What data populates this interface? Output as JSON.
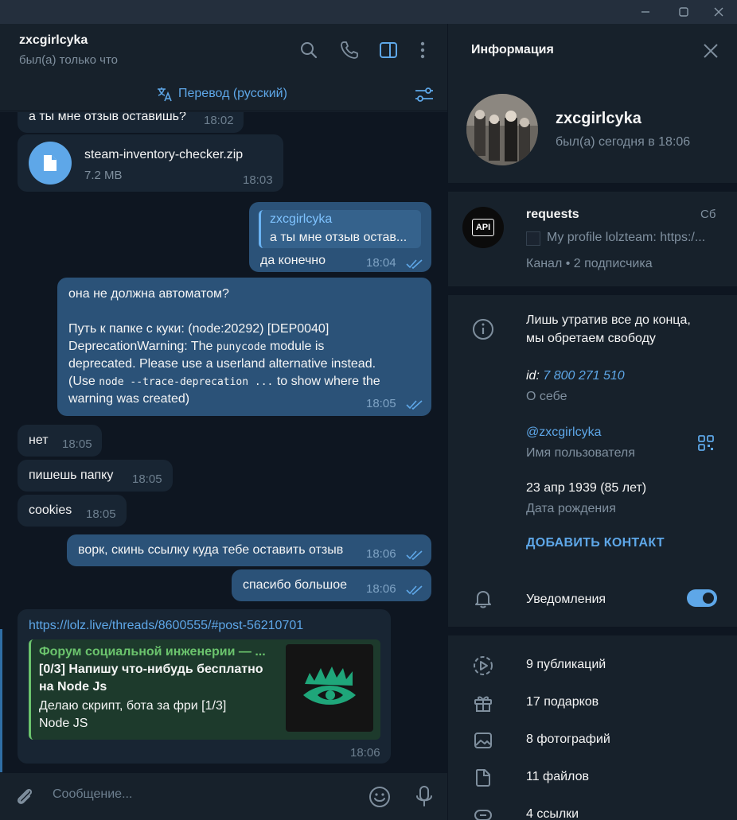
{
  "chat": {
    "peer_name": "zxcgirlcyka",
    "peer_status": "был(а) только что",
    "translate_label": "Перевод (русский)",
    "composer_placeholder": "Сообщение...",
    "messages": {
      "m1": {
        "text": "а ты мне отзыв оставишь?",
        "time": "18:02"
      },
      "file": {
        "name": "steam-inventory-checker.zip",
        "size": "7.2 MB",
        "time": "18:03"
      },
      "m3": {
        "reply_name": "zxcgirlcyka",
        "reply_text": "а ты мне отзыв остав...",
        "text": "да конечно",
        "time": "18:04"
      },
      "m4": {
        "line1": "она не должна автоматом?",
        "line2": "Путь к папке с куки: (node:20292) [DEP0040]",
        "line3a": "DeprecationWarning: The ",
        "line3code": "punycode",
        "line3b": " module is",
        "line4": "deprecated. Please use a userland alternative instead.",
        "line5a": "(Use ",
        "line5code": "node --trace-deprecation ...",
        "line5b": " to show where the",
        "line6": "warning was created)",
        "time": "18:05"
      },
      "m5": {
        "text": "нет",
        "time": "18:05"
      },
      "m6": {
        "text": "пишешь папку",
        "time": "18:05"
      },
      "m7": {
        "text": "cookies",
        "time": "18:05"
      },
      "m8": {
        "text": "ворк, скинь ссылку куда тебе оставить отзыв",
        "time": "18:06"
      },
      "m9": {
        "text": "спасибо большое",
        "time": "18:06"
      },
      "m10": {
        "link": "https://lolz.live/threads/8600555/#post-56210701",
        "preview_site": "Форум социальной инженерии — ...",
        "preview_title_1": "[0/3] Напишу что-нибудь бесплатно",
        "preview_title_2": "на Node Js",
        "preview_desc_1": "Делаю скрипт, бота за фри [1/3]",
        "preview_desc_2": "Node JS",
        "time": "18:06"
      }
    }
  },
  "info": {
    "title": "Информация",
    "name": "zxcgirlcyka",
    "status": "был(а) сегодня в 18:06",
    "channel": {
      "name": "requests",
      "day": "Сб",
      "last_message": "My profile lolzteam: https:/...",
      "meta": "Канал • 2 подписчика",
      "avatar_label": "API"
    },
    "bio": {
      "line1": "Лишь утратив все до конца,",
      "line2": "мы обретаем свободу"
    },
    "id": {
      "prefix": "id: ",
      "value": "7 800 271 510",
      "label": "О себе"
    },
    "username": {
      "value": "@zxcgirlcyka",
      "label": "Имя пользователя"
    },
    "birthday": {
      "value": "23 апр 1939 (85 лет)",
      "label": "Дата рождения"
    },
    "add_contact": "ДОБАВИТЬ КОНТАКТ",
    "notifications": {
      "label": "Уведомления",
      "enabled": true
    },
    "media": {
      "posts": "9 публикаций",
      "gifts": "17 подарков",
      "photos": "8 фотографий",
      "files": "11 файлов",
      "links": "4 ссылки"
    }
  },
  "colors": {
    "accent": "#5ea7e8",
    "bubble_in": "#182533",
    "bubble_out": "#2b5278",
    "background": "#0e1621",
    "panel": "#17212b",
    "link_green": "#6bc46d"
  }
}
